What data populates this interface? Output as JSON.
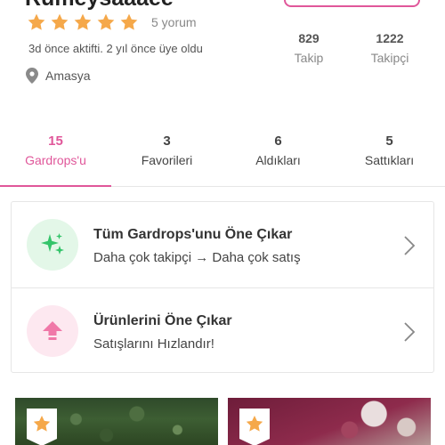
{
  "profile": {
    "username": "Rumeysaaaee",
    "rating_stars": 5,
    "review_count_text": "5 yorum",
    "activity_text": "3d önce aktifti. 2 yıl önce üye oldu",
    "location": "Amasya",
    "stats": {
      "following_count": "829",
      "following_label": "Takip",
      "followers_count": "1222",
      "followers_label": "Takipçi"
    }
  },
  "tabs": [
    {
      "count": "15",
      "label": "Gardrops'u",
      "active": true
    },
    {
      "count": "3",
      "label": "Favorileri",
      "active": false
    },
    {
      "count": "6",
      "label": "Aldıkları",
      "active": false
    },
    {
      "count": "5",
      "label": "Sattıkları",
      "active": false
    }
  ],
  "promos": [
    {
      "title": "Tüm Gardrops'unu Öne Çıkar",
      "subtitle": "Daha çok takipçi → Daha çok satış",
      "icon": "sparkle-icon"
    },
    {
      "title": "Ürünlerini Öne Çıkar",
      "subtitle": "Satışlarını Hızlandır!",
      "icon": "arrow-up-icon"
    }
  ],
  "products": [
    {
      "badge_icon": "star-badge-icon"
    },
    {
      "badge_icon": "star-badge-icon"
    }
  ],
  "colors": {
    "accent": "#e0579a",
    "star": "#f5a84a",
    "sparkle_green": "#34c46a",
    "arrow_pink": "#f078a8"
  }
}
